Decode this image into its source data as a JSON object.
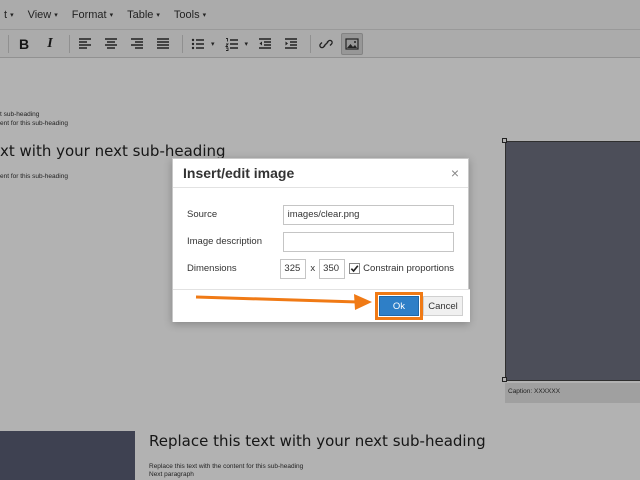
{
  "menubar": {
    "items": [
      {
        "label": "t"
      },
      {
        "label": "View"
      },
      {
        "label": "Format"
      },
      {
        "label": "Table"
      },
      {
        "label": "Tools"
      }
    ]
  },
  "toolbar": {
    "bold": "B",
    "italic": "I",
    "icons": [
      "align-left-icon",
      "align-center-icon",
      "align-right-icon",
      "align-justify-icon",
      "bullet-list-icon",
      "numbered-list-icon",
      "outdent-icon",
      "indent-icon",
      "link-icon",
      "image-icon"
    ]
  },
  "document": {
    "line1": "t sub-heading",
    "line2": "ent for this sub-heading",
    "heading1": "xt with your next sub-heading",
    "line3": "ent for this sub-heading",
    "caption": "Caption: XXXXXX",
    "heading2": "Replace this text with your next sub-heading",
    "para1": "Replace this text with the content for this sub-heading",
    "para2": "Next paragraph"
  },
  "dialog": {
    "title": "Insert/edit image",
    "close": "×",
    "source_label": "Source",
    "source_value": "images/clear.png",
    "description_label": "Image description",
    "description_value": "",
    "dimensions_label": "Dimensions",
    "width": "325",
    "x": "x",
    "height": "350",
    "constrain_label": "Constrain proportions",
    "ok": "Ok",
    "cancel": "Cancel"
  },
  "colors": {
    "highlight": "#f07a15",
    "ok_button": "#2e7fc7"
  }
}
